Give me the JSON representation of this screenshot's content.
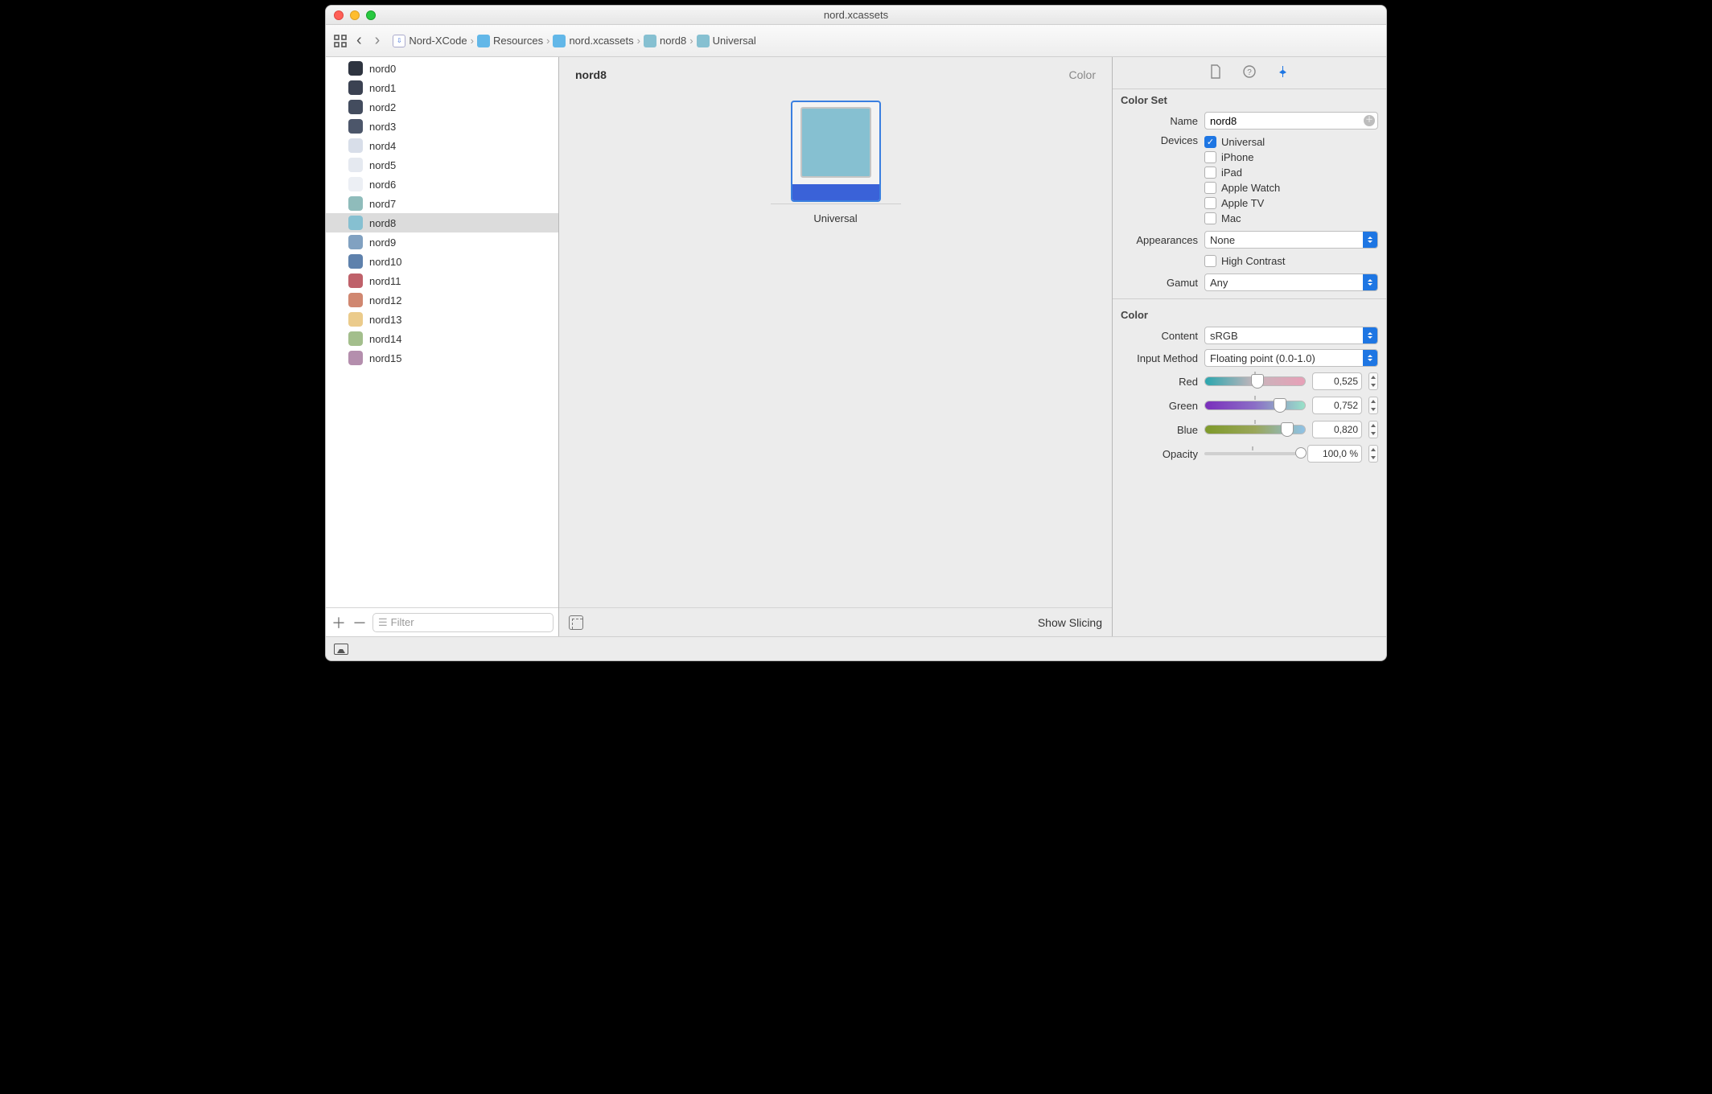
{
  "window": {
    "title": "nord.xcassets"
  },
  "breadcrumb": [
    {
      "icon": "swift",
      "label": "Nord-XCode"
    },
    {
      "icon": "folder",
      "label": "Resources"
    },
    {
      "icon": "assets",
      "label": "nord.xcassets"
    },
    {
      "icon": "swatch",
      "label": "nord8",
      "color": "#86c0d1"
    },
    {
      "icon": "swatch",
      "label": "Universal",
      "color": "#86c0d1"
    }
  ],
  "sidebar": {
    "filter_placeholder": "Filter",
    "selected_index": 8,
    "items": [
      {
        "name": "nord0",
        "color": "#2e3440"
      },
      {
        "name": "nord1",
        "color": "#3b4252"
      },
      {
        "name": "nord2",
        "color": "#434c5e"
      },
      {
        "name": "nord3",
        "color": "#4c566a"
      },
      {
        "name": "nord4",
        "color": "#d8dee9"
      },
      {
        "name": "nord5",
        "color": "#e5e9f0"
      },
      {
        "name": "nord6",
        "color": "#eceff4"
      },
      {
        "name": "nord7",
        "color": "#8fbcbb"
      },
      {
        "name": "nord8",
        "color": "#86c0d1"
      },
      {
        "name": "nord9",
        "color": "#81a1c1"
      },
      {
        "name": "nord10",
        "color": "#5e81ac"
      },
      {
        "name": "nord11",
        "color": "#bf616a"
      },
      {
        "name": "nord12",
        "color": "#d08770"
      },
      {
        "name": "nord13",
        "color": "#ebcb8b"
      },
      {
        "name": "nord14",
        "color": "#a3be8c"
      },
      {
        "name": "nord15",
        "color": "#b48ead"
      }
    ]
  },
  "canvas": {
    "title": "nord8",
    "type_label": "Color",
    "well_label": "Universal",
    "well_color": "#86c0d1",
    "footer_action": "Show Slicing"
  },
  "inspector": {
    "section_colorset": "Color Set",
    "name_label": "Name",
    "name_value": "nord8",
    "devices_label": "Devices",
    "devices": [
      {
        "label": "Universal",
        "checked": true
      },
      {
        "label": "iPhone",
        "checked": false
      },
      {
        "label": "iPad",
        "checked": false
      },
      {
        "label": "Apple Watch",
        "checked": false
      },
      {
        "label": "Apple TV",
        "checked": false
      },
      {
        "label": "Mac",
        "checked": false
      }
    ],
    "appearances_label": "Appearances",
    "appearances_value": "None",
    "high_contrast": {
      "label": "High Contrast",
      "checked": false
    },
    "gamut_label": "Gamut",
    "gamut_value": "Any",
    "section_color": "Color",
    "content_label": "Content",
    "content_value": "sRGB",
    "input_method_label": "Input Method",
    "input_method_value": "Floating point (0.0-1.0)",
    "channels": {
      "red": {
        "label": "Red",
        "value": "0,525",
        "percent": 52.5
      },
      "green": {
        "label": "Green",
        "value": "0,752",
        "percent": 75.2
      },
      "blue": {
        "label": "Blue",
        "value": "0,820",
        "percent": 82.0
      }
    },
    "opacity": {
      "label": "Opacity",
      "value": "100,0 %",
      "percent": 100
    }
  }
}
